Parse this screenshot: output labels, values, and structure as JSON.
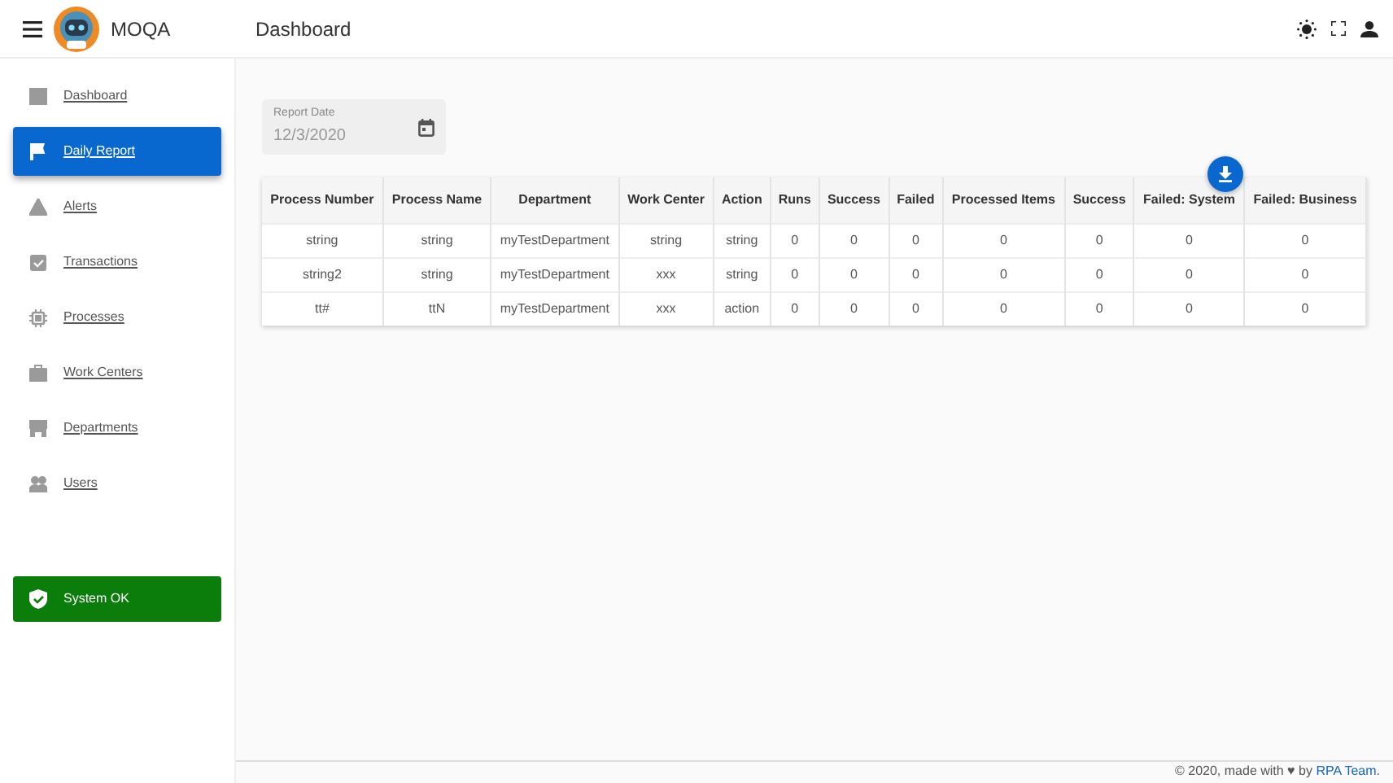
{
  "app": {
    "name": "MOQA"
  },
  "header": {
    "title": "Dashboard"
  },
  "sidebar": {
    "items": [
      {
        "label": "Dashboard",
        "selected": false
      },
      {
        "label": "Daily Report",
        "selected": true
      },
      {
        "label": "Alerts",
        "selected": false
      },
      {
        "label": "Transactions",
        "selected": false
      },
      {
        "label": "Processes",
        "selected": false
      },
      {
        "label": "Work Centers",
        "selected": false
      },
      {
        "label": "Departments",
        "selected": false
      },
      {
        "label": "Users",
        "selected": false
      }
    ],
    "status": {
      "label": "System OK",
      "ok": true
    }
  },
  "report_date": {
    "label": "Report Date",
    "value": "12/3/2020"
  },
  "table": {
    "columns": [
      "Process Number",
      "Process Name",
      "Department",
      "Work Center",
      "Action",
      "Runs",
      "Success",
      "Failed",
      "Processed Items",
      "Success",
      "Failed: System",
      "Failed: Business"
    ],
    "rows": [
      [
        "string",
        "string",
        "myTestDepartment",
        "string",
        "string",
        "0",
        "0",
        "0",
        "0",
        "0",
        "0",
        "0"
      ],
      [
        "string2",
        "string",
        "myTestDepartment",
        "xxx",
        "string",
        "0",
        "0",
        "0",
        "0",
        "0",
        "0",
        "0"
      ],
      [
        "tt#",
        "ttN",
        "myTestDepartment",
        "xxx",
        "action",
        "0",
        "0",
        "0",
        "0",
        "0",
        "0",
        "0"
      ]
    ]
  },
  "footer": {
    "text": "© 2020, made with ♥ by ",
    "link": "RPA Team",
    "end": "."
  }
}
